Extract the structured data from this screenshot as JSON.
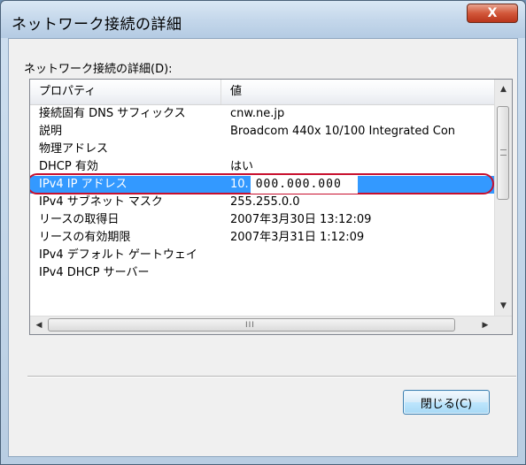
{
  "window": {
    "title": "ネットワーク接続の詳細",
    "close_glyph": "X"
  },
  "section_label": "ネットワーク接続の詳細(D):",
  "listview": {
    "columns": {
      "property": "プロパティ",
      "value": "値"
    },
    "rows": [
      {
        "property": "接続固有 DNS サフィックス",
        "value": "cnw.ne.jp"
      },
      {
        "property": "説明",
        "value": "Broadcom 440x 10/100 Integrated Con"
      },
      {
        "property": "物理アドレス",
        "value": ""
      },
      {
        "property": "DHCP 有効",
        "value": "はい"
      },
      {
        "property": "IPv4 IP アドレス",
        "value": "10.",
        "redacted_value": "000.000.000",
        "selected": true
      },
      {
        "property": "IPv4 サブネット マスク",
        "value": "255.255.0.0"
      },
      {
        "property": "リースの取得日",
        "value": "2007年3月30日 13:12:09"
      },
      {
        "property": "リースの有効期限",
        "value": "2007年3月31日 1:12:09"
      },
      {
        "property": "IPv4 デフォルト ゲートウェイ",
        "value": ""
      },
      {
        "property": "IPv4 DHCP サーバー",
        "value": ""
      }
    ],
    "vscroll": {
      "up": "▲",
      "down": "▼",
      "grip": "≡"
    },
    "hscroll": {
      "left": "◀",
      "right": "▶",
      "grip": "III"
    }
  },
  "buttons": {
    "close_label": "閉じる(C)"
  },
  "colors": {
    "selection": "#3399ff",
    "highlight_ring": "#c8102e",
    "title_close": "#c4442a"
  }
}
